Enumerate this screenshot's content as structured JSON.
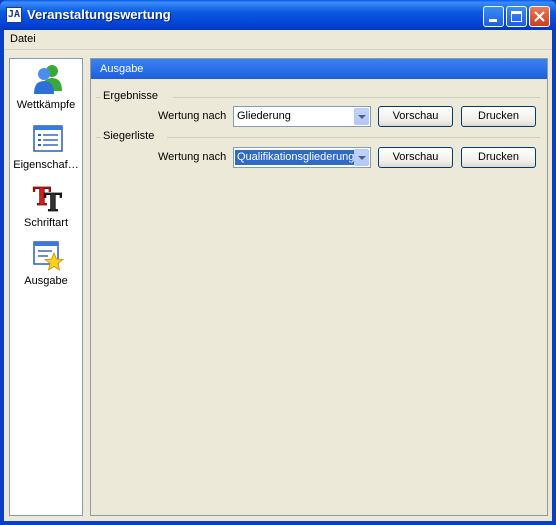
{
  "window": {
    "title": "Veranstaltungswertung",
    "app_icon": "JA"
  },
  "menu": {
    "items": [
      {
        "label": "Datei"
      }
    ]
  },
  "sidebar": {
    "items": [
      {
        "label": "Wettkämpfe",
        "icon": "users-icon"
      },
      {
        "label": "Eigenschaf…",
        "icon": "properties-icon"
      },
      {
        "label": "Schriftart",
        "icon": "font-icon"
      },
      {
        "label": "Ausgabe",
        "icon": "output-icon"
      }
    ]
  },
  "panel": {
    "title": "Ausgabe",
    "groups": [
      {
        "title": "Ergebnisse",
        "field_label": "Wertung nach",
        "selected": "Gliederung",
        "preview_label": "Vorschau",
        "print_label": "Drucken"
      },
      {
        "title": "Siegerliste",
        "field_label": "Wertung nach",
        "selected": "Qualifikationsgliederung",
        "preview_label": "Vorschau",
        "print_label": "Drucken"
      }
    ]
  },
  "colors": {
    "titlebar": "#0a5ae0",
    "panel_header": "#2a6ee8",
    "selection": "#316ac5"
  }
}
